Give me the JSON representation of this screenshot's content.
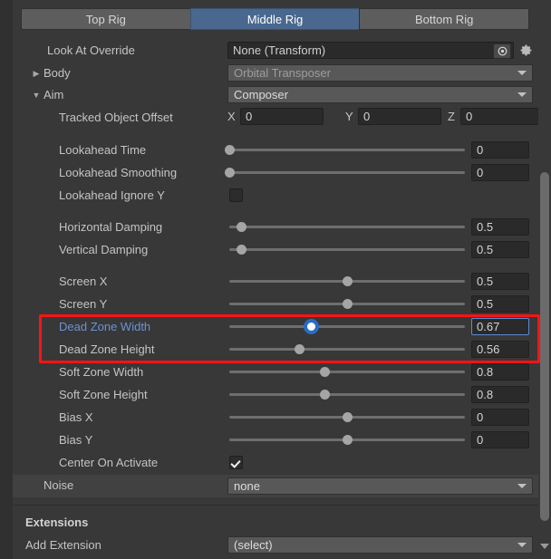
{
  "tabs": [
    {
      "label": "Top Rig",
      "active": false
    },
    {
      "label": "Middle Rig",
      "active": true
    },
    {
      "label": "Bottom Rig",
      "active": false
    }
  ],
  "look_at_override": {
    "label": "Look At Override",
    "value": "None (Transform)",
    "picker_icon": "object-picker-icon",
    "settings_icon": "gear-icon"
  },
  "body": {
    "label": "Body",
    "value": "Orbital Transposer",
    "foldout": "▶"
  },
  "aim": {
    "label": "Aim",
    "value": "Composer",
    "foldout": "▼"
  },
  "tracked_object_offset": {
    "label": "Tracked Object Offset",
    "x_label": "X",
    "x_value": "0",
    "y_label": "Y",
    "y_value": "0",
    "z_label": "Z",
    "z_value": "0"
  },
  "sliders": [
    {
      "label": "Lookahead Time",
      "value": "0",
      "pos": 0.0,
      "active": false,
      "highlighted": false
    },
    {
      "label": "Lookahead Smoothing",
      "value": "0",
      "pos": 0.0,
      "active": false,
      "highlighted": false
    },
    {
      "label": "Horizontal Damping",
      "value": "0.5",
      "pos": 0.05,
      "active": false,
      "highlighted": false
    },
    {
      "label": "Vertical Damping",
      "value": "0.5",
      "pos": 0.05,
      "active": false,
      "highlighted": false
    },
    {
      "label": "Screen X",
      "value": "0.5",
      "pos": 0.5,
      "active": false,
      "highlighted": false
    },
    {
      "label": "Screen Y",
      "value": "0.5",
      "pos": 0.5,
      "active": false,
      "highlighted": false
    },
    {
      "label": "Dead Zone Width",
      "value": "0.67",
      "pos": 0.345,
      "active": true,
      "highlighted": true
    },
    {
      "label": "Dead Zone Height",
      "value": "0.56",
      "pos": 0.295,
      "active": false,
      "highlighted": true
    },
    {
      "label": "Soft Zone Width",
      "value": "0.8",
      "pos": 0.405,
      "active": false,
      "highlighted": false
    },
    {
      "label": "Soft Zone Height",
      "value": "0.8",
      "pos": 0.405,
      "active": false,
      "highlighted": false
    },
    {
      "label": "Bias X",
      "value": "0",
      "pos": 0.5,
      "active": false,
      "highlighted": false
    },
    {
      "label": "Bias Y",
      "value": "0",
      "pos": 0.5,
      "active": false,
      "highlighted": false
    }
  ],
  "lookahead_ignore_y": {
    "label": "Lookahead Ignore Y",
    "checked": false
  },
  "center_on_activate": {
    "label": "Center On Activate",
    "checked": true
  },
  "noise": {
    "label": "Noise",
    "value": "none"
  },
  "extensions": {
    "title": "Extensions",
    "add_label": "Add Extension",
    "add_value": "(select)"
  },
  "highlight": {
    "color": "#fe1313"
  },
  "scrollbar": {
    "down_arrow_icon": "chevron-down-icon"
  }
}
